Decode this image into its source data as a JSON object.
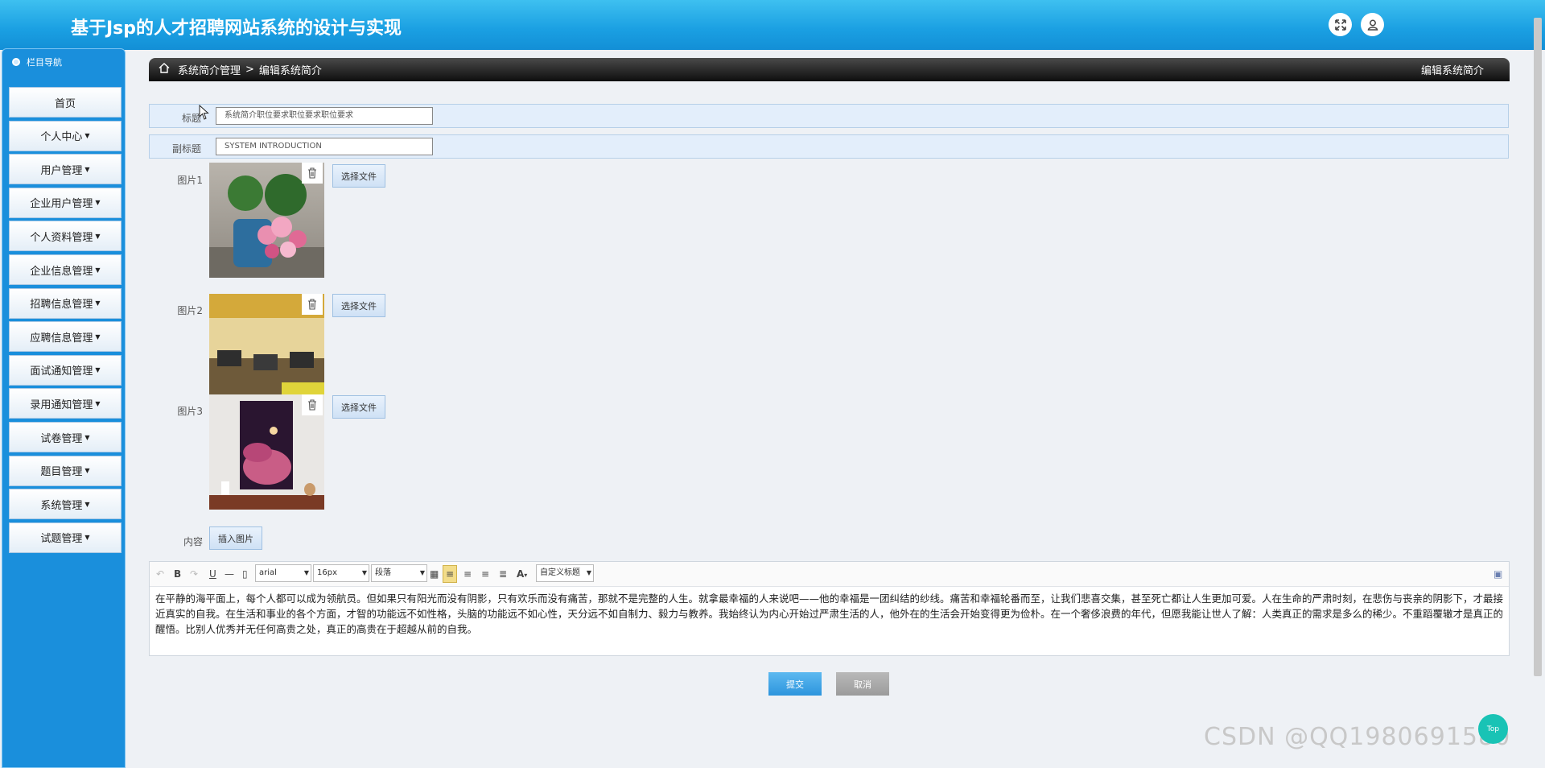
{
  "app": {
    "title": "基于Jsp的人才招聘网站系统的设计与实现"
  },
  "header": {
    "icons": [
      "fullscreen-icon",
      "user-icon"
    ]
  },
  "sidebar": {
    "heading": "栏目导航",
    "items": [
      {
        "label": "首页",
        "dropdown": false
      },
      {
        "label": "个人中心",
        "dropdown": true
      },
      {
        "label": "用户管理",
        "dropdown": true
      },
      {
        "label": "企业用户管理",
        "dropdown": true
      },
      {
        "label": "个人资料管理",
        "dropdown": true
      },
      {
        "label": "企业信息管理",
        "dropdown": true
      },
      {
        "label": "招聘信息管理",
        "dropdown": true
      },
      {
        "label": "应聘信息管理",
        "dropdown": true
      },
      {
        "label": "面试通知管理",
        "dropdown": true
      },
      {
        "label": "录用通知管理",
        "dropdown": true
      },
      {
        "label": "试卷管理",
        "dropdown": true
      },
      {
        "label": "题目管理",
        "dropdown": true
      },
      {
        "label": "系统管理",
        "dropdown": true
      },
      {
        "label": "试题管理",
        "dropdown": true
      }
    ]
  },
  "breadcrumb": {
    "parent": "系统简介管理",
    "separator": ">",
    "current": "编辑系统简介",
    "right_title": "编辑系统简介"
  },
  "form": {
    "title_label": "标题",
    "title_value": "系统简介职位要求职位要求职位要求",
    "subtitle_label": "副标题",
    "subtitle_value": "SYSTEM INTRODUCTION",
    "images": [
      {
        "label": "图片1",
        "button": "选择文件"
      },
      {
        "label": "图片2",
        "button": "选择文件"
      },
      {
        "label": "图片3",
        "button": "选择文件"
      }
    ],
    "content_label": "内容",
    "insert_image_button": "插入图片"
  },
  "editor": {
    "font_family": "arial",
    "font_size": "16px",
    "paragraph": "段落",
    "custom_heading": "自定义标题",
    "content": "在平静的海平面上，每个人都可以成为领航员。但如果只有阳光而没有阴影，只有欢乐而没有痛苦，那就不是完整的人生。就拿最幸福的人来说吧——他的幸福是一团纠结的纱线。痛苦和幸福轮番而至，让我们悲喜交集，甚至死亡都让人生更加可爱。人在生命的严肃时刻，在悲伤与丧亲的阴影下，才最接近真实的自我。在生活和事业的各个方面，才智的功能远不如性格，头脑的功能远不如心性，天分远不如自制力、毅力与教养。我始终认为内心开始过严肃生活的人，他外在的生活会开始变得更为俭朴。在一个奢侈浪费的年代，但愿我能让世人了解：人类真正的需求是多么的稀少。不重蹈覆辙才是真正的醒悟。比别人优秀并无任何高贵之处，真正的高贵在于超越从前的自我。"
  },
  "actions": {
    "submit": "提交",
    "cancel": "取消"
  },
  "watermark": "CSDN @QQ1980691580",
  "float_button": "Top",
  "colors": {
    "header": "#1a9fe2",
    "sidebar": "#1a8fdc",
    "submit": "#3aa3e6",
    "cancel": "#a6a6a6"
  }
}
